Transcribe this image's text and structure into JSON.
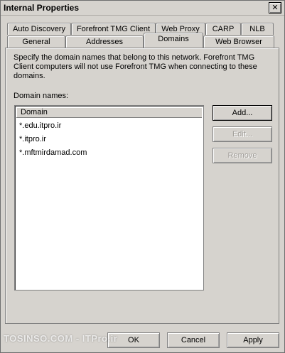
{
  "window": {
    "title": "Internal Properties",
    "close_glyph": "✕"
  },
  "tabs_back_row": [
    {
      "label": "Auto Discovery"
    },
    {
      "label": "Forefront TMG Client"
    },
    {
      "label": "Web Proxy"
    },
    {
      "label": "CARP"
    },
    {
      "label": "NLB"
    }
  ],
  "tabs_front_row": [
    {
      "label": "General"
    },
    {
      "label": "Addresses"
    },
    {
      "label": "Domains",
      "active": true
    },
    {
      "label": "Web Browser"
    }
  ],
  "domains": {
    "description": "Specify the domain names that belong to this network. Forefront TMG Client computers will not use Forefront TMG when connecting to these domains.",
    "list_label": "Domain names:",
    "column_header": "Domain",
    "items": [
      "*.edu.itpro.ir",
      "*.itpro.ir",
      "*.mftmirdamad.com"
    ],
    "buttons": {
      "add": "Add...",
      "edit": "Edit...",
      "remove": "Remove"
    }
  },
  "footer": {
    "ok": "OK",
    "cancel": "Cancel",
    "apply": "Apply"
  },
  "watermark": "TOSINSO.COM - ITPro.ir",
  "colors": {
    "dialog_bg": "#d6d3ce",
    "list_bg": "#ffffff",
    "disabled_text": "#a09d98"
  }
}
